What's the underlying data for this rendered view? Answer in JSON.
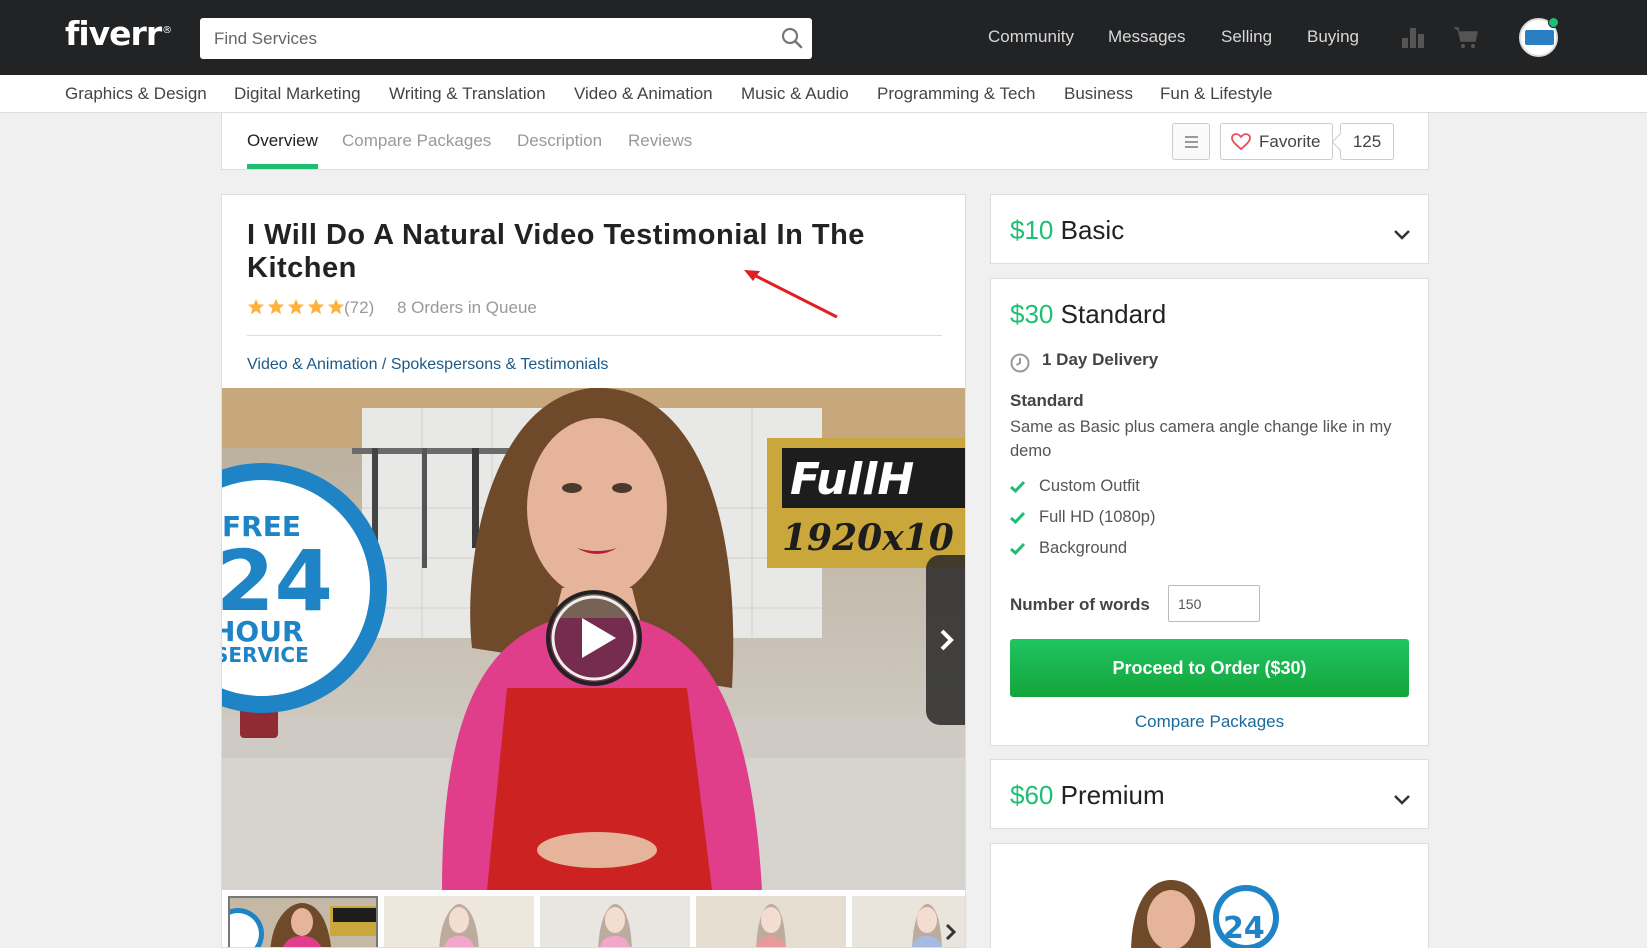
{
  "topbar": {
    "logo": "fiverr",
    "search_placeholder": "Find Services",
    "nav": [
      "Community",
      "Messages",
      "Selling",
      "Buying"
    ]
  },
  "categories": [
    "Graphics & Design",
    "Digital Marketing",
    "Writing & Translation",
    "Video & Animation",
    "Music & Audio",
    "Programming & Tech",
    "Business",
    "Fun & Lifestyle"
  ],
  "subnav": {
    "tabs": [
      "Overview",
      "Compare Packages",
      "Description",
      "Reviews"
    ],
    "favorite_label": "Favorite",
    "favorite_count": "125"
  },
  "gig": {
    "title": "I Will Do A Natural Video Testimonial In The Kitchen",
    "rating": 5,
    "review_count": "(72)",
    "queue": "8 Orders in Queue",
    "breadcrumb_category": "Video & Animation",
    "breadcrumb_sep": " / ",
    "breadcrumb_subcategory": "Spokespersons & Testimonials",
    "video_overlay": {
      "badge_line1": "FREE",
      "badge_line2": "24",
      "badge_line3": "HOUR",
      "badge_line4": "SERVICE",
      "hd_line1": "FullH",
      "hd_line2": "1920x10"
    }
  },
  "packages": {
    "basic": {
      "price": "$10",
      "name": "Basic"
    },
    "standard": {
      "price": "$30",
      "name": "Standard",
      "delivery": "1 Day Delivery",
      "title": "Standard",
      "description": "Same as Basic plus camera angle change like in my demo",
      "features": [
        "Custom Outfit",
        "Full HD (1080p)",
        "Background"
      ],
      "words_label": "Number of words",
      "words_value": "150",
      "order_button": "Proceed to Order ($30)",
      "compare_link": "Compare Packages"
    },
    "premium": {
      "price": "$60",
      "name": "Premium"
    }
  },
  "colors": {
    "brand_green": "#1dbf73",
    "topbar": "#222325",
    "link_blue": "#1a5a8a"
  }
}
